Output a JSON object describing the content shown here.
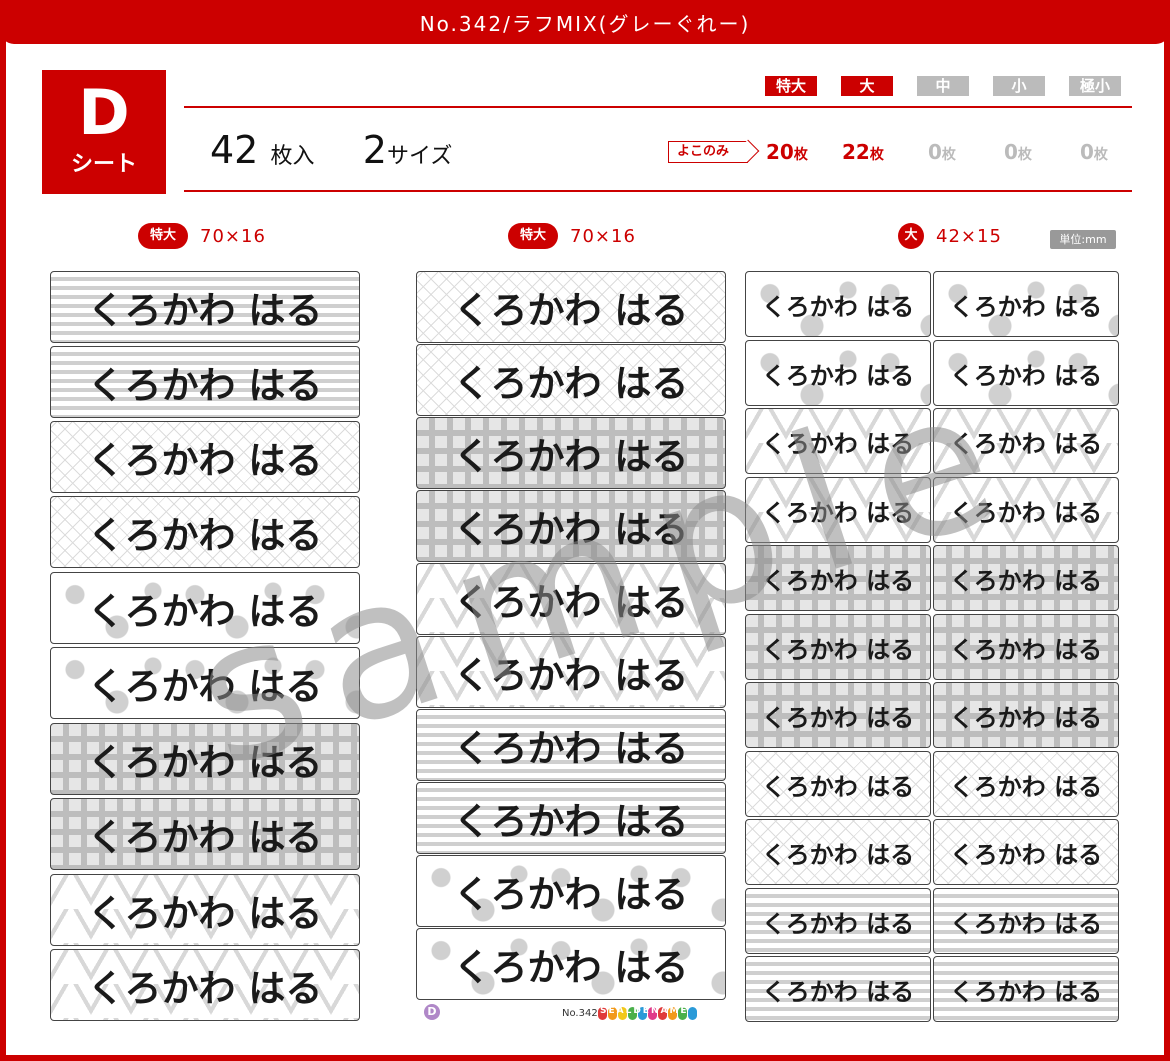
{
  "header": {
    "title": "No.342/ラフMIX(グレーぐれー)"
  },
  "sheet": {
    "letter": "D",
    "word": "シート"
  },
  "summary": {
    "count": "42",
    "count_unit": "枚入",
    "sizes": "2",
    "sizes_unit": "サイズ"
  },
  "size_tabs": [
    {
      "label": "特大",
      "active": true
    },
    {
      "label": "大",
      "active": true
    },
    {
      "label": "中",
      "active": false
    },
    {
      "label": "小",
      "active": false
    },
    {
      "label": "極小",
      "active": false
    }
  ],
  "orientation_label": "よこのみ",
  "quantities": [
    {
      "value": "20",
      "unit": "枚"
    },
    {
      "value": "22",
      "unit": "枚"
    },
    {
      "value": "0",
      "unit": "枚"
    },
    {
      "value": "0",
      "unit": "枚"
    },
    {
      "value": "0",
      "unit": "枚"
    }
  ],
  "columns": [
    {
      "size": "特大",
      "dim": "70×16"
    },
    {
      "size": "特大",
      "dim": "70×16"
    },
    {
      "size": "大",
      "dim": "42×15"
    }
  ],
  "unit_label": "単位:mm",
  "name_text": "くろかわ はる",
  "watermark": "sample",
  "footer": {
    "d_mark": "D",
    "number": "No.342",
    "brand": "SEALDENAME"
  },
  "colors": {
    "accent": "#cc0000",
    "inactive": "#bbbbbb",
    "border": "#444444"
  }
}
